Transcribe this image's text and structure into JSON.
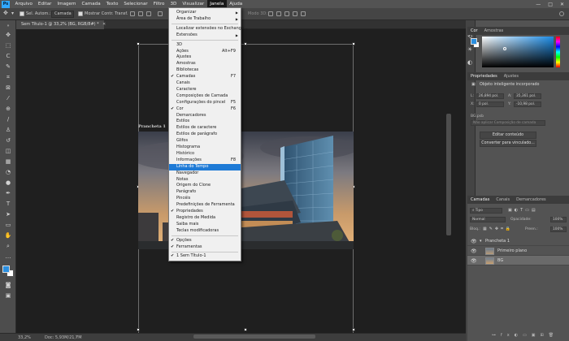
{
  "menubar": {
    "logo": "Ps",
    "items": [
      "Arquivo",
      "Editar",
      "Imagem",
      "Camada",
      "Texto",
      "Selecionar",
      "Filtro",
      "3D",
      "Visualizar",
      "Janela",
      "Ajuda"
    ],
    "active_index": 9,
    "window_controls": [
      "—",
      "□",
      "✕"
    ]
  },
  "options_bar": {
    "auto_select_label": "Sel. Autom.:",
    "auto_select_value": "Camada",
    "show_transform_label": "Mostrar Contr. Transf.",
    "mode_3d_label": "Modo 3D:"
  },
  "document": {
    "tab_title": "Sem Título-1 @ 33,2% (BG, RGB/8#) *",
    "artboard_label": "Prancheta 1",
    "zoom": "33,2%",
    "doc_info": "Doc: 5,93M/21,7M"
  },
  "janela_menu": {
    "items": [
      {
        "label": "Organizar",
        "submenu": true
      },
      {
        "label": "Área de Trabalho",
        "submenu": true
      },
      {
        "sep": true
      },
      {
        "label": "Localizar extensões no Exchange..."
      },
      {
        "label": "Extensões",
        "submenu": true
      },
      {
        "sep": true
      },
      {
        "label": "3D"
      },
      {
        "label": "Ações",
        "shortcut": "Alt+F9"
      },
      {
        "label": "Ajustes"
      },
      {
        "label": "Amostras"
      },
      {
        "label": "Bibliotecas"
      },
      {
        "label": "Camadas",
        "checked": true,
        "shortcut": "F7"
      },
      {
        "label": "Canais"
      },
      {
        "label": "Caractere"
      },
      {
        "label": "Composições de Camada"
      },
      {
        "label": "Configurações do pincel",
        "shortcut": "F5"
      },
      {
        "label": "Cor",
        "checked": true,
        "shortcut": "F6"
      },
      {
        "label": "Demarcadores"
      },
      {
        "label": "Estilos"
      },
      {
        "label": "Estilos de caractere"
      },
      {
        "label": "Estilos de parágrafo"
      },
      {
        "label": "Glifos"
      },
      {
        "label": "Histograma"
      },
      {
        "label": "Histórico"
      },
      {
        "label": "Informações",
        "shortcut": "F8"
      },
      {
        "label": "Linha do Tempo",
        "highlighted": true
      },
      {
        "label": "Navegador"
      },
      {
        "label": "Notas"
      },
      {
        "label": "Origem do Clone"
      },
      {
        "label": "Parágrafo"
      },
      {
        "label": "Pincéis"
      },
      {
        "label": "Predefinições de Ferramenta"
      },
      {
        "label": "Propriedades",
        "checked": true
      },
      {
        "label": "Registro de Medida"
      },
      {
        "label": "Saiba mais"
      },
      {
        "label": "Teclas modificadoras"
      },
      {
        "sep": true
      },
      {
        "label": "Opções",
        "checked": true
      },
      {
        "label": "Ferramentas",
        "checked": true
      },
      {
        "sep": true
      },
      {
        "label": "1 Sem Título-1",
        "checked": true
      }
    ]
  },
  "color_panel": {
    "tabs": [
      "Cor",
      "Amostras"
    ]
  },
  "properties_panel": {
    "tabs": [
      "Propriedades",
      "Ajustes"
    ],
    "object_type": "Objeto inteligente incorporado",
    "L_label": "L:",
    "L_value": "26,894 pol.",
    "A_label": "A:",
    "A_value": "35,361 pol.",
    "X_label": "X:",
    "X_value": "0 pol.",
    "Y_label": "Y:",
    "Y_value": "-10,98 pol.",
    "filename": "BG.psb",
    "layer_comp_placeholder": "Não aplicar Composição de camada",
    "edit_button": "Editar conteúdo",
    "convert_button": "Converter para vinculado..."
  },
  "layers_panel": {
    "tabs": [
      "Camadas",
      "Canais",
      "Demarcadores"
    ],
    "filter_label": "Tipo",
    "blend_mode": "Normal",
    "opacity_label": "Opacidade:",
    "opacity_value": "100%",
    "lock_label": "Bloq.:",
    "fill_label": "Preen.:",
    "fill_value": "100%",
    "layers": [
      {
        "name": "Prancheta 1",
        "type": "artboard"
      },
      {
        "name": "Primeiro plano",
        "type": "layer"
      },
      {
        "name": "BG",
        "type": "smart-object",
        "selected": true
      }
    ]
  },
  "colors": {
    "accent": "#31a8ff",
    "menu_highlight": "#1e7ad6",
    "foreground": "#2b8fe0",
    "background": "#ffffff"
  }
}
